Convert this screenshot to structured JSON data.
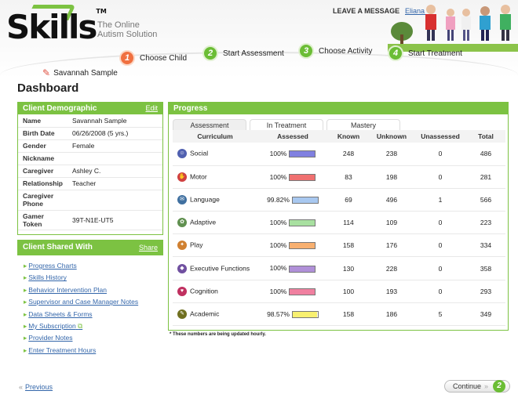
{
  "header": {
    "logo": "Skills",
    "logo_tm": "TM",
    "tagline_line1": "The Online",
    "tagline_line2": "Autism Solution",
    "leave_message": "LEAVE A MESSAGE",
    "user_name": "Eliana ▼"
  },
  "steps": [
    {
      "number": "1",
      "label": "Choose Child"
    },
    {
      "number": "2",
      "label": "Start Assessment"
    },
    {
      "number": "3",
      "label": "Choose Activity"
    },
    {
      "number": "4",
      "label": "Start Treatment"
    }
  ],
  "child_name": "Savannah Sample",
  "page_title": "Dashboard",
  "demographic": {
    "title": "Client Demographic",
    "edit": "Edit",
    "rows": [
      {
        "k": "Name",
        "v": "Savannah Sample"
      },
      {
        "k": "Birth Date",
        "v": "06/26/2008 (5 yrs.)"
      },
      {
        "k": "Gender",
        "v": "Female"
      },
      {
        "k": "Nickname",
        "v": ""
      },
      {
        "k": "Caregiver",
        "v": "Ashley C."
      },
      {
        "k": "Relationship",
        "v": "Teacher"
      },
      {
        "k": "Caregiver Phone",
        "v": ""
      },
      {
        "k": "Gamer Token",
        "v": "39T-N1E-UT5"
      }
    ]
  },
  "shared": {
    "title": "Client Shared With",
    "share": "Share",
    "links": [
      "Progress Charts",
      "Skills History",
      "Behavior Intervention Plan",
      "Supervisor and Case Manager Notes",
      "Data Sheets & Forms",
      "My Subscription",
      "Provider Notes",
      "Enter Treatment Hours"
    ]
  },
  "progress": {
    "title": "Progress",
    "tabs": [
      "Assessment",
      "In Treatment",
      "Mastery"
    ],
    "columns": [
      "Curriculum",
      "Assessed",
      "Known",
      "Unknown",
      "Unassessed",
      "Total"
    ],
    "rows": [
      {
        "name": "Social",
        "assessed": "100%",
        "known": "248",
        "unknown": "238",
        "unassessed": "0",
        "total": "486",
        "color": "#8080e0",
        "icon_color": "#5060b0",
        "fill": 1.0
      },
      {
        "name": "Motor",
        "assessed": "100%",
        "known": "83",
        "unknown": "198",
        "unassessed": "0",
        "total": "281",
        "color": "#f07070",
        "icon_color": "#d04040",
        "fill": 1.0
      },
      {
        "name": "Language",
        "assessed": "99.82%",
        "known": "69",
        "unknown": "496",
        "unassessed": "1",
        "total": "566",
        "color": "#a8c8f0",
        "icon_color": "#4070a0",
        "fill": 0.998
      },
      {
        "name": "Adaptive",
        "assessed": "100%",
        "known": "114",
        "unknown": "109",
        "unassessed": "0",
        "total": "223",
        "color": "#a8e0a0",
        "icon_color": "#609050",
        "fill": 1.0
      },
      {
        "name": "Play",
        "assessed": "100%",
        "known": "158",
        "unknown": "176",
        "unassessed": "0",
        "total": "334",
        "color": "#f8b070",
        "icon_color": "#d08030",
        "fill": 1.0
      },
      {
        "name": "Executive Functions",
        "assessed": "100%",
        "known": "130",
        "unknown": "228",
        "unassessed": "0",
        "total": "358",
        "color": "#b090d8",
        "icon_color": "#7050a0",
        "fill": 1.0
      },
      {
        "name": "Cognition",
        "assessed": "100%",
        "known": "100",
        "unknown": "193",
        "unassessed": "0",
        "total": "293",
        "color": "#f080a0",
        "icon_color": "#c03060",
        "fill": 1.0
      },
      {
        "name": "Academic",
        "assessed": "98.57%",
        "known": "158",
        "unknown": "186",
        "unassessed": "5",
        "total": "349",
        "color": "#f8f070",
        "icon_color": "#707020",
        "fill": 0.986
      }
    ],
    "note": "* These numbers are being updated hourly."
  },
  "footer": {
    "previous": "Previous",
    "continue": "Continue",
    "continue_step": "2"
  },
  "colors": {
    "accent": "#7cc242",
    "link": "#3366aa",
    "active_step": "#f07040"
  }
}
